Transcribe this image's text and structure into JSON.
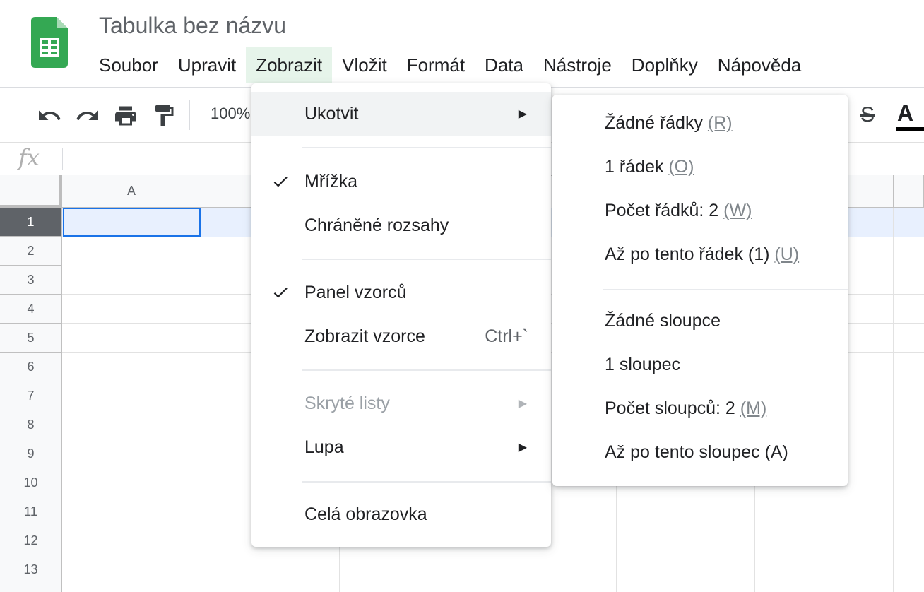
{
  "doc_title": "Tabulka bez názvu",
  "menubar": [
    "Soubor",
    "Upravit",
    "Zobrazit",
    "Vložit",
    "Formát",
    "Data",
    "Nástroje",
    "Doplňky",
    "Nápověda"
  ],
  "active_menu": "Zobrazit",
  "toolbar": {
    "zoom": "100%",
    "icons": [
      "undo-icon",
      "redo-icon",
      "print-icon",
      "paint-format-icon",
      "strikethrough-icon",
      "text-color-icon"
    ],
    "strike_glyph": "S",
    "text_color_glyph": "A"
  },
  "formula_bar": {
    "fx": "fx",
    "value": ""
  },
  "grid": {
    "columns": [
      "A"
    ],
    "rows": [
      "1",
      "2",
      "3",
      "4",
      "5",
      "6",
      "7",
      "8",
      "9",
      "10",
      "11",
      "12",
      "13"
    ],
    "selected_row": "1",
    "active_cell": "A1"
  },
  "view_menu": {
    "items": [
      {
        "label": "Ukotvit",
        "submenu": true
      },
      {
        "label": "Mřížka",
        "checked": true
      },
      {
        "label": "Chráněné rozsahy"
      },
      {
        "label": "Panel vzorců",
        "checked": true
      },
      {
        "label": "Zobrazit vzorce",
        "shortcut": "Ctrl+`"
      },
      {
        "label": "Skryté listy",
        "submenu": true,
        "disabled": true
      },
      {
        "label": "Lupa",
        "submenu": true
      },
      {
        "label": "Celá obrazovka"
      }
    ],
    "check_glyph": "✓",
    "arrow_glyph": "▶"
  },
  "freeze_menu": {
    "rows_items": [
      {
        "label": "Žádné řádky ",
        "key": "(R)"
      },
      {
        "label": "1 řádek ",
        "key": "(O)"
      },
      {
        "label": "Počet řádků: 2 ",
        "key": "(W)"
      },
      {
        "label": "Až po tento řádek (1) ",
        "key": "(U)"
      }
    ],
    "cols_items": [
      {
        "label": "Žádné sloupce"
      },
      {
        "label": "1 sloupec"
      },
      {
        "label": "Počet sloupců: 2 ",
        "key": "(M)"
      },
      {
        "label": "Až po tento sloupec (A)"
      }
    ]
  }
}
